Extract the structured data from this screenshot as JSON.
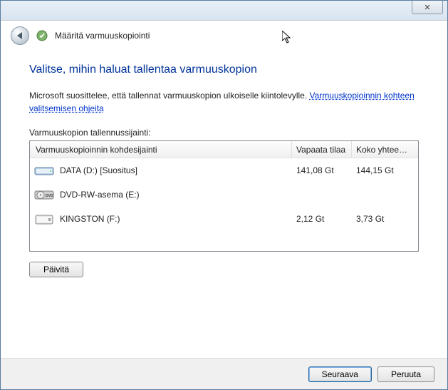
{
  "titlebar": {
    "close_glyph": "✕"
  },
  "header": {
    "app_title": "Määritä varmuuskopiointi"
  },
  "page": {
    "title": "Valitse, mihin haluat tallentaa varmuuskopion",
    "description_prefix": "Microsoft suosittelee, että tallennat varmuuskopion ulkoiselle kiintolevylle. ",
    "description_link": "Varmuuskopioinnin kohteen valitsemisen ohjeita",
    "list_label": "Varmuuskopion tallennussijainti:",
    "columns": {
      "c1": "Varmuuskopioinnin kohdesijainti",
      "c2": "Vapaata tilaa",
      "c3": "Koko yhtee…"
    },
    "drives": [
      {
        "name": "DATA (D:) [Suositus]",
        "free": "141,08 Gt",
        "total": "144,15 Gt",
        "icon": "hdd"
      },
      {
        "name": "DVD-RW-asema (E:)",
        "free": "",
        "total": "",
        "icon": "dvd"
      },
      {
        "name": "KINGSTON (F:)",
        "free": "2,12 Gt",
        "total": "3,73 Gt",
        "icon": "ext"
      }
    ],
    "refresh_label": "Päivitä"
  },
  "footer": {
    "next": "Seuraava",
    "cancel": "Peruuta"
  }
}
